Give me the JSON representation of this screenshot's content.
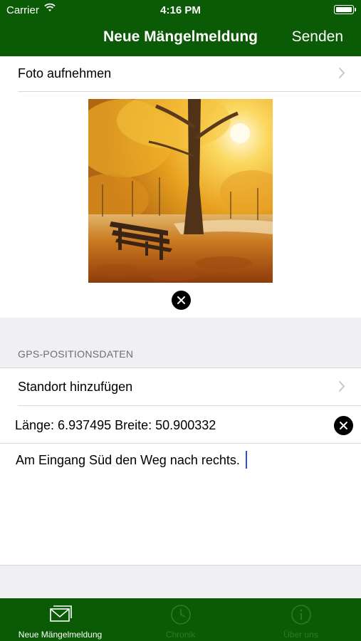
{
  "status_bar": {
    "carrier": "Carrier",
    "time": "4:16 PM"
  },
  "nav": {
    "title": "Neue Mängelmeldung",
    "send_label": "Senden"
  },
  "photo_row": {
    "label": "Foto aufnehmen"
  },
  "gps": {
    "section_title": "GPS-POSITIONSDATEN",
    "add_location_label": "Standort hinzufügen",
    "coordinates": "Länge: 6.937495 Breite: 50.900332"
  },
  "note": {
    "text": "Am Eingang Süd den Weg nach rechts."
  },
  "tabs": [
    {
      "label": "Neue Mängelmeldung",
      "icon": "envelope-icon",
      "active": true
    },
    {
      "label": "Chronik",
      "icon": "clock-icon",
      "active": false
    },
    {
      "label": "Über uns",
      "icon": "info-icon",
      "active": false
    }
  ],
  "colors": {
    "brand": "#0b5a05",
    "background": "#efeff4",
    "cursor": "#2b4fd8"
  }
}
